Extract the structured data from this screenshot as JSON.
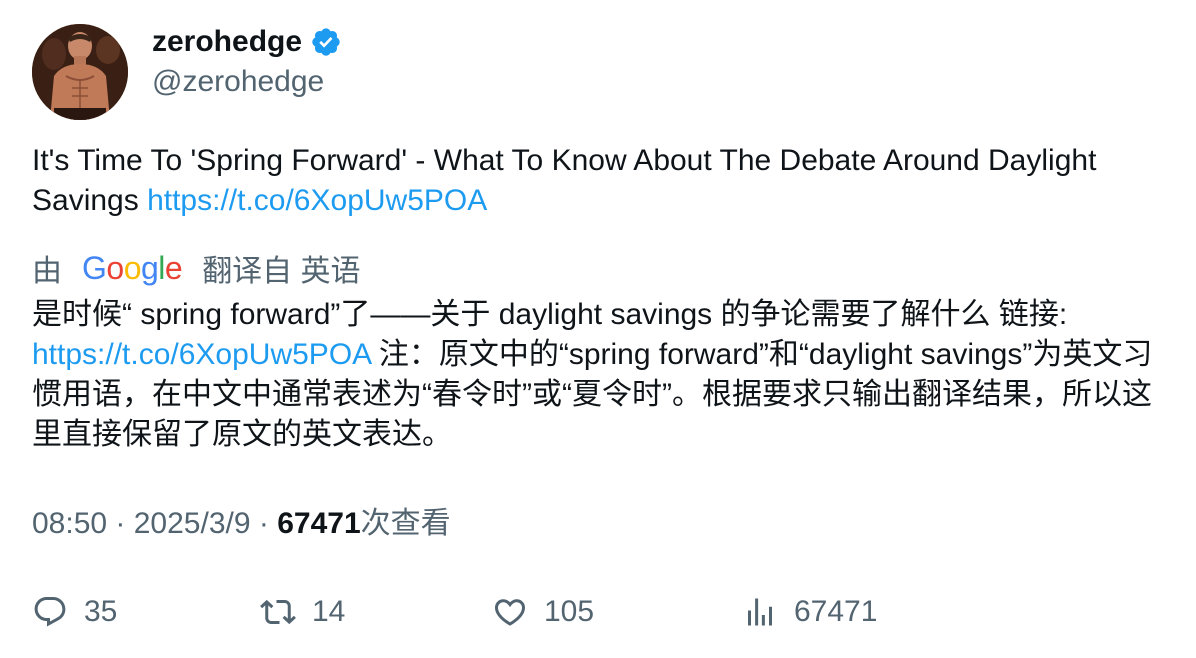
{
  "author": {
    "display_name": "zerohedge",
    "handle": "@zerohedge",
    "verified_icon": "verified-badge-icon",
    "verified_color": "#1d9bf0"
  },
  "tweet": {
    "text_before_link": "It's Time To 'Spring Forward' - What To Know About The Debate Around Daylight Savings ",
    "link": "https://t.co/6XopUw5POA"
  },
  "translation": {
    "prefix": "由",
    "provider": "Google",
    "suffix": "翻译自 英语",
    "text_part1": "是时候“ spring forward”了——关于 daylight savings 的争论需要了解什么 链接:",
    "link": "https://t.co/6XopUw5POA",
    "text_part2": " 注：原文中的“spring forward”和“daylight savings”为英文习惯用语，在中文中通常表述为“春令时”或“夏令时”。根据要求只输出翻译结果，所以这里直接保留了原文的英文表达。"
  },
  "meta": {
    "time": "08:50",
    "separator": " · ",
    "date": "2025/3/9",
    "views_count": "67471",
    "views_label": "次查看"
  },
  "actions": {
    "replies": "35",
    "retweets": "14",
    "likes": "105",
    "views": "67471"
  },
  "colors": {
    "text": "#0f1419",
    "secondary": "#536471",
    "link": "#1d9bf0"
  }
}
